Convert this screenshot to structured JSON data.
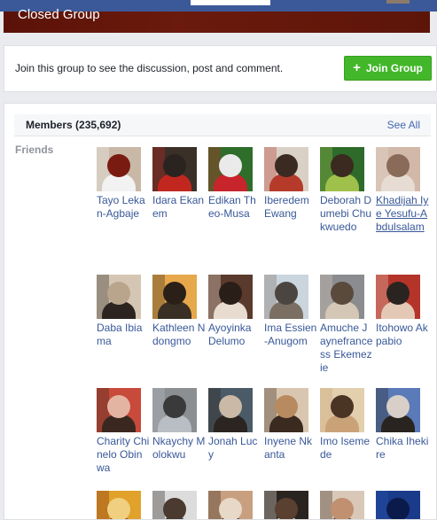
{
  "header": {
    "cover_title": "Closed Group"
  },
  "join": {
    "message": "Join this group to see the discussion, post and comment.",
    "button_label": "Join Group"
  },
  "members": {
    "title": "Members (235,692)",
    "see_all": "See All",
    "friends_label": "Friends",
    "people": [
      {
        "name": "Tayo Lekan-Agbaje",
        "colors": [
          "#c9b8a6",
          "#f2f2f2",
          "#7a1b12"
        ]
      },
      {
        "name": "Idara Ekanem",
        "colors": [
          "#3a3028",
          "#c2271f",
          "#2a2320"
        ]
      },
      {
        "name": "Edikan Theo-Musa",
        "colors": [
          "#2e6d2a",
          "#c8242b",
          "#eaeaea"
        ]
      },
      {
        "name": "Iberedem Ewang",
        "colors": [
          "#d9d0c6",
          "#b63a2a",
          "#3a2a22"
        ]
      },
      {
        "name": "Deborah Dumebi Chukwuedo",
        "colors": [
          "#2e6b2b",
          "#9fc04a",
          "#3b2a20"
        ]
      },
      {
        "name": "Khadijah Iye Yesufu-Abdulsalam",
        "colors": [
          "#d2b8a8",
          "#e6dcd3",
          "#8a6a58"
        ],
        "underline": true
      },
      {
        "name": "Daba Ibiama",
        "colors": [
          "#d5c6b3",
          "#2b2420",
          "#b9a58c"
        ]
      },
      {
        "name": "Kathleen Ndongmo",
        "colors": [
          "#e6a84a",
          "#3a2f24",
          "#2a2018"
        ]
      },
      {
        "name": "Ayoyinka Delumo",
        "colors": [
          "#5a3a2c",
          "#e8dcd0",
          "#2a1e18"
        ]
      },
      {
        "name": "Ima Essien-Anugom",
        "colors": [
          "#cbd5de",
          "#7a6f62",
          "#4a4540"
        ]
      },
      {
        "name": "Amuche Jaynefrancess Ekemezie",
        "colors": [
          "#8a8c8f",
          "#d4c7b6",
          "#5a4a3c"
        ]
      },
      {
        "name": "Itohowo Akpabio",
        "colors": [
          "#b5342a",
          "#e3c8b5",
          "#2a2420"
        ]
      },
      {
        "name": "Charity Chinelo Obinwa",
        "colors": [
          "#c84a3a",
          "#3a2820",
          "#e4b4a2"
        ]
      },
      {
        "name": "Nkaychy Molokwu",
        "colors": [
          "#8c8f92",
          "#b8bec4",
          "#3a3a3a"
        ]
      },
      {
        "name": "Jonah Lucy",
        "colors": [
          "#4a5a66",
          "#2b2420",
          "#c9b9a6"
        ]
      },
      {
        "name": "Inyene Nkanta",
        "colors": [
          "#d9c6b0",
          "#3a2a20",
          "#b88a60"
        ]
      },
      {
        "name": "Imo Isemede",
        "colors": [
          "#e2cfae",
          "#c9a278",
          "#4a3424"
        ]
      },
      {
        "name": "Chika Ihekire",
        "colors": [
          "#5a7ab8",
          "#2a2420",
          "#d8d0c8"
        ]
      },
      {
        "name": "",
        "colors": [
          "#e0a22a",
          "#7a2a10",
          "#f0d080"
        ]
      },
      {
        "name": "",
        "colors": [
          "#dcdcdc",
          "#2a2420",
          "#4a3a30"
        ]
      },
      {
        "name": "",
        "colors": [
          "#c8a080",
          "#3a2a20",
          "#e8d8c8"
        ]
      },
      {
        "name": "",
        "colors": [
          "#2a2420",
          "#e8e0d8",
          "#5a4030"
        ]
      },
      {
        "name": "",
        "colors": [
          "#d9c8b8",
          "#3a2a20",
          "#c09070"
        ]
      },
      {
        "name": "",
        "colors": [
          "#1a3a8a",
          "#2a5ab0",
          "#0a1a4a"
        ]
      }
    ]
  }
}
